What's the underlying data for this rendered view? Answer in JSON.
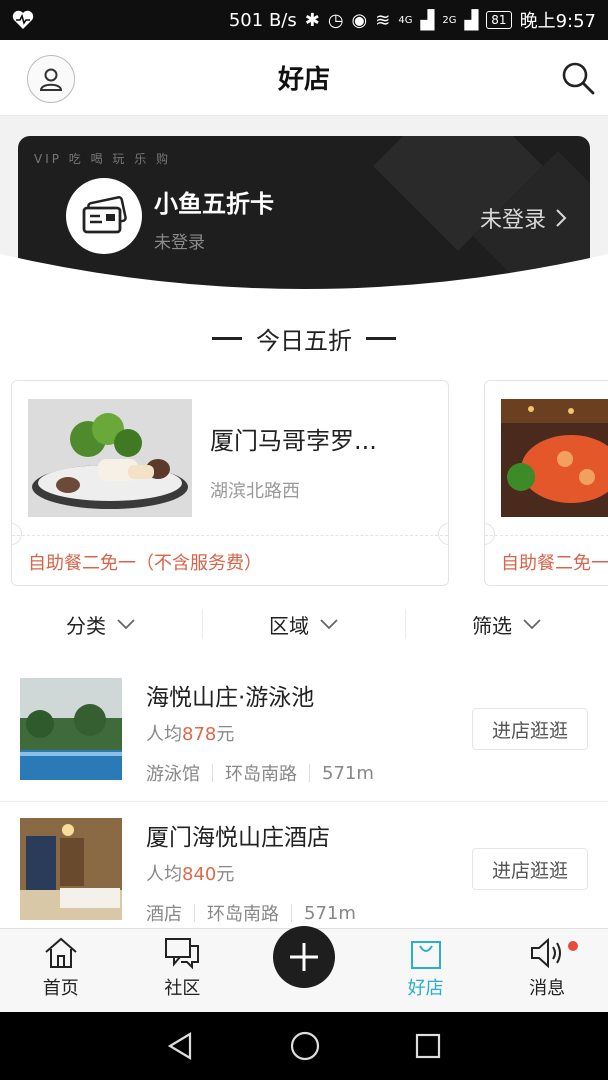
{
  "status_bar": {
    "speed": "501 B/s",
    "network_a": "4G",
    "network_b": "2G",
    "battery": "81",
    "time": "晚上9:57"
  },
  "header": {
    "title": "好店"
  },
  "vip_card": {
    "tag": "VIP 吃 喝 玩 乐 购",
    "name": "小鱼五折卡",
    "status": "未登录",
    "login_label": "未登录"
  },
  "section": {
    "title": "今日五折"
  },
  "deals": [
    {
      "name": "厦门马哥孛罗...",
      "address": "湖滨北路西",
      "promo": "自助餐二免一（不含服务费）"
    },
    {
      "promo": "自助餐二免一"
    }
  ],
  "filters": [
    {
      "label": "分类"
    },
    {
      "label": "区域"
    },
    {
      "label": "筛选"
    }
  ],
  "shops": [
    {
      "name": "海悦山庄·游泳池",
      "price_prefix": "人均",
      "price": "878",
      "price_suffix": "元",
      "category": "游泳馆",
      "road": "环岛南路",
      "distance": "571m",
      "button": "进店逛逛"
    },
    {
      "name": "厦门海悦山庄酒店",
      "price_prefix": "人均",
      "price": "840",
      "price_suffix": "元",
      "category": "酒店",
      "road": "环岛南路",
      "distance": "571m",
      "button": "进店逛逛"
    }
  ],
  "bottom_nav": [
    {
      "label": "首页",
      "icon": "home-icon"
    },
    {
      "label": "社区",
      "icon": "community-icon"
    },
    {
      "label": "好店",
      "icon": "shop-bag-icon"
    },
    {
      "label": "消息",
      "icon": "speaker-icon"
    }
  ],
  "colors": {
    "accent": "#2ab0c8",
    "price": "#e0694a",
    "promo": "#d9644a",
    "card_bg": "#1e1e1e",
    "badge": "#e84a3c"
  }
}
